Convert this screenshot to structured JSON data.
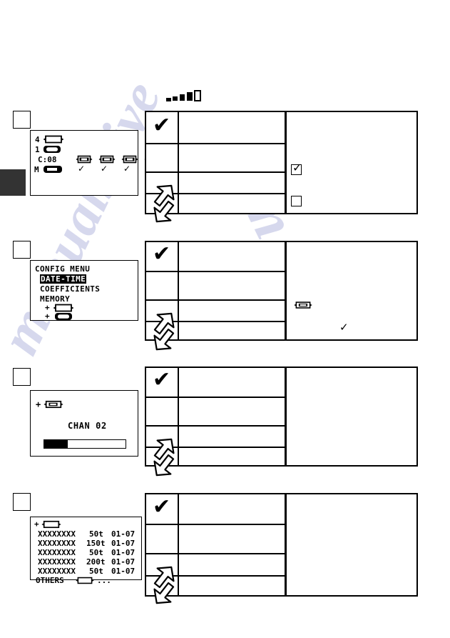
{
  "page": {
    "watermark_left": "manualshive",
    "watermark_right": "com",
    "level_indicator": {
      "name": "signal-level-indicator",
      "bars": [
        1,
        2,
        3,
        4,
        5
      ],
      "active": 4,
      "total": 5
    }
  },
  "blocks": [
    {
      "step_label": "",
      "lcd": {
        "type": "status-screen",
        "lines": [
          {
            "prefix": "4",
            "icon": "cartridge-empty"
          },
          {
            "prefix": "1",
            "icon": "cartridge-full"
          },
          {
            "prefix": "C:08",
            "icons": [
              "cartridge-1",
              "cartridge-2",
              "cartridge-3",
              "cartridge-4"
            ]
          },
          {
            "prefix": "M",
            "icon": "cartridge-memory",
            "ticks": [
              "✓",
              "✓",
              "✓",
              "✓"
            ]
          }
        ],
        "code": "C:08",
        "row4_count": 4
      },
      "table": {
        "rows": [
          "",
          "",
          "",
          ""
        ],
        "icon_col": [
          "check",
          "",
          "arrow-up",
          "arrow-down"
        ]
      },
      "panel": {
        "checkbox_checked": {
          "label": "",
          "checked": true
        },
        "checkbox_unchecked": {
          "label": "",
          "checked": false
        }
      }
    },
    {
      "step_label": "",
      "lcd": {
        "type": "menu-screen",
        "title": "CONFIG MENU",
        "items": [
          {
            "label": "DATE-TIME",
            "selected": true
          },
          {
            "label": "COEFFICIENTS",
            "selected": false
          },
          {
            "label": "MEMORY",
            "selected": false
          },
          {
            "label": "+",
            "icon": "cartridge-empty",
            "selected": false
          },
          {
            "label": "+",
            "icon": "cartridge-full",
            "selected": false
          }
        ]
      },
      "table": {
        "rows": [
          "",
          "",
          "",
          ""
        ],
        "icon_col": [
          "check",
          "",
          "arrow-up",
          "arrow-down"
        ]
      },
      "panel": {
        "icon": "cartridge-empty",
        "tick": "✓"
      }
    },
    {
      "step_label": "",
      "lcd": {
        "type": "progress-screen",
        "header_icon": "cartridge-empty",
        "header_prefix": "+",
        "channel_label": "CHAN 02",
        "progress_percent": 29
      },
      "table": {
        "rows": [
          "",
          "",
          "",
          ""
        ],
        "icon_col": [
          "check",
          "",
          "arrow-up",
          "arrow-down"
        ]
      },
      "panel": {}
    },
    {
      "step_label": "",
      "lcd": {
        "type": "list-screen",
        "header_icon": "cartridge-empty",
        "header_prefix": "+",
        "columns": [
          "name",
          "amount",
          "date"
        ],
        "rows": [
          {
            "name": "XXXXXXXX",
            "amount": "50t",
            "date": "01-07"
          },
          {
            "name": "XXXXXXXX",
            "amount": "150t",
            "date": "01-07"
          },
          {
            "name": "XXXXXXXX",
            "amount": "50t",
            "date": "01-07"
          },
          {
            "name": "XXXXXXXX",
            "amount": "200t",
            "date": "01-07"
          },
          {
            "name": "XXXXXXXX",
            "amount": "50t",
            "date": "01-07"
          }
        ],
        "footer_label": "OTHERS",
        "footer_icon": "cartridge-empty",
        "footer_suffix": "..."
      },
      "table": {
        "rows": [
          "",
          "",
          "",
          ""
        ],
        "icon_col": [
          "check",
          "",
          "arrow-up",
          "arrow-down"
        ]
      },
      "panel": {}
    }
  ],
  "icons": {
    "check": "✔",
    "small_check": "✓",
    "arrow_up": "arrow-up-icon",
    "arrow_down": "arrow-down-icon"
  }
}
